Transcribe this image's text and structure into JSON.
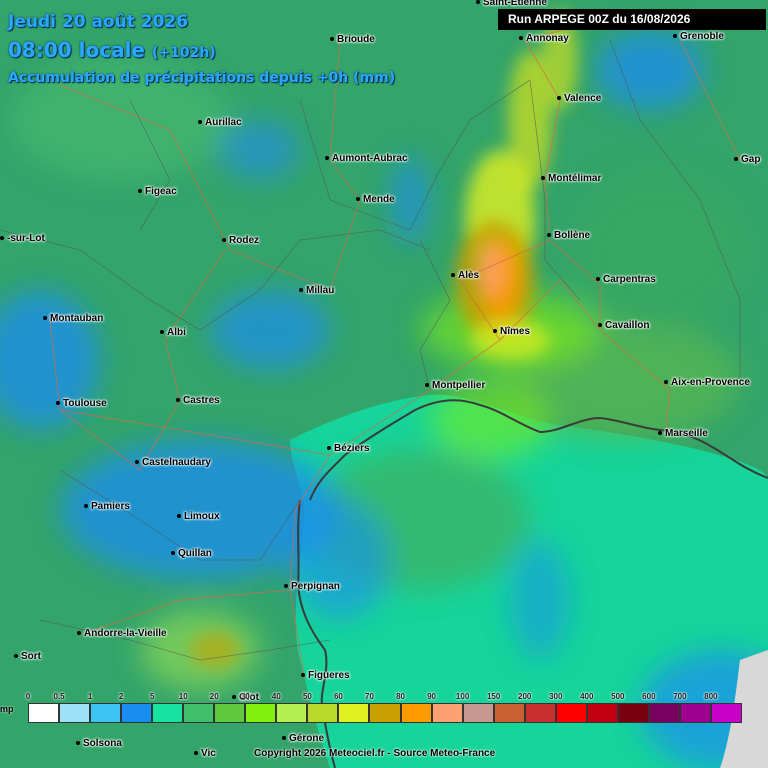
{
  "header": {
    "date": "Jeudi 20 août 2026",
    "time": "08:00 locale",
    "offset": "(+102h)",
    "subtitle": "Accumulation de précipitations depuis +0h (mm)"
  },
  "run_label": "Run ARPEGE 00Z du 16/08/2026",
  "copyright": "Copyright 2026 Meteociel.fr - Source Meteo-France",
  "corner_label": "mp",
  "cities": [
    {
      "name": "Saint-Étienne"
    },
    {
      "name": "Brioude"
    },
    {
      "name": "Annonay"
    },
    {
      "name": "Grenoble"
    },
    {
      "name": "Valence"
    },
    {
      "name": "Aurillac"
    },
    {
      "name": "Aumont-Aubrac"
    },
    {
      "name": "Gap"
    },
    {
      "name": "Montélimar"
    },
    {
      "name": "Figeac"
    },
    {
      "name": "Mende"
    },
    {
      "name": "-sur-Lot"
    },
    {
      "name": "Rodez"
    },
    {
      "name": "Bollène"
    },
    {
      "name": "Alès"
    },
    {
      "name": "Carpentras"
    },
    {
      "name": "Millau"
    },
    {
      "name": "Montauban"
    },
    {
      "name": "Albi"
    },
    {
      "name": "Nîmes"
    },
    {
      "name": "Cavaillon"
    },
    {
      "name": "Montpellier"
    },
    {
      "name": "Aix-en-Provence"
    },
    {
      "name": "Toulouse"
    },
    {
      "name": "Castres"
    },
    {
      "name": "Marseille"
    },
    {
      "name": "Béziers"
    },
    {
      "name": "Castelnaudary"
    },
    {
      "name": "Pamiers"
    },
    {
      "name": "Limoux"
    },
    {
      "name": "Quillan"
    },
    {
      "name": "Perpignan"
    },
    {
      "name": "Andorre-la-Vieille"
    },
    {
      "name": "Sort"
    },
    {
      "name": "Figueres"
    },
    {
      "name": "Solsona"
    },
    {
      "name": "Vic"
    },
    {
      "name": "Gérone"
    },
    {
      "name": "Olot"
    }
  ],
  "legend": {
    "labels": [
      "0",
      "0.5",
      "1",
      "2",
      "5",
      "10",
      "20",
      "30",
      "40",
      "50",
      "60",
      "70",
      "80",
      "90",
      "100",
      "150",
      "200",
      "300",
      "400",
      "500",
      "600",
      "700",
      "800"
    ],
    "colors": [
      "#ffffff",
      "#9ee0f5",
      "#3ec3f5",
      "#1a8ef0",
      "#18e2a0",
      "#3fbf6a",
      "#5fc83c",
      "#7ff00f",
      "#b4f050",
      "#b8d82a",
      "#e0f020",
      "#c8a000",
      "#ff9a00",
      "#ffa070",
      "#c89890",
      "#c86030",
      "#c83030",
      "#ff0000",
      "#c00010",
      "#7a0010",
      "#780060",
      "#a00090",
      "#c800c8"
    ]
  }
}
